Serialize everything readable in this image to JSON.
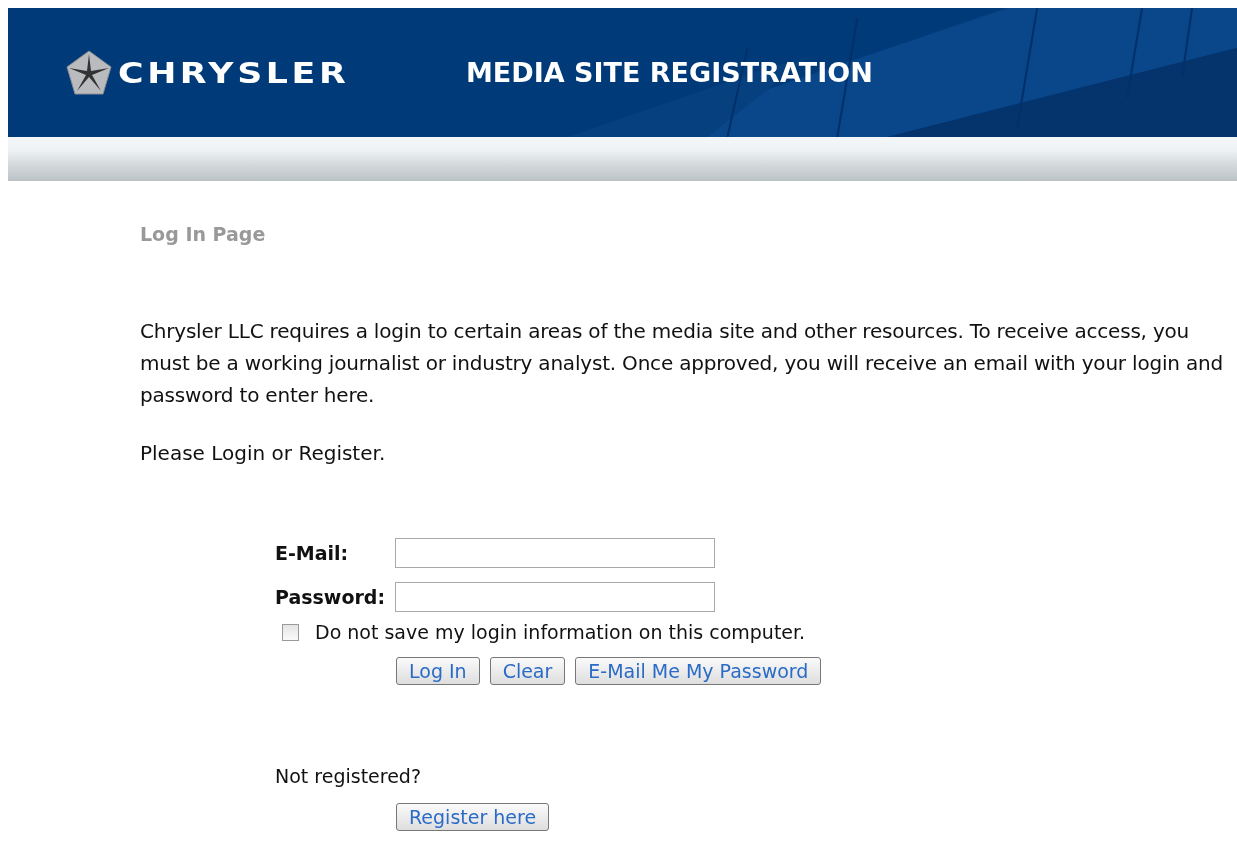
{
  "header": {
    "brand": "CHRYSLER",
    "title": "MEDIA SITE REGISTRATION"
  },
  "page_title": "Log In Page",
  "intro": "Chrysler LLC requires a login to certain areas of the media site and other resources. To receive access, you must be a working journalist or industry analyst. Once approved, you will receive an email with your login and password to enter here.",
  "prompt": "Please Login or Register.",
  "form": {
    "fields": [
      {
        "label": "E-Mail:"
      },
      {
        "label": "Password:"
      }
    ],
    "checkbox": {
      "label": "Do not save my login information on this computer.",
      "checked": false
    },
    "buttons": [
      "Log In",
      "Clear",
      "E-Mail Me My Password"
    ]
  },
  "register": {
    "question": "Not registered?",
    "button": "Register here"
  }
}
